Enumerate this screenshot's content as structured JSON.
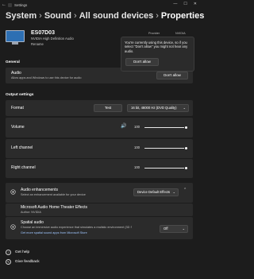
{
  "window": {
    "title": "Settings",
    "back_glyph": "←",
    "min_glyph": "—",
    "max_glyph": "☐",
    "close_glyph": "✕"
  },
  "breadcrumb": {
    "items": [
      "System",
      "Sound",
      "All sound devices",
      "Properties"
    ],
    "separator": "›"
  },
  "device": {
    "name": "ES07D03",
    "subtitle": "NVIDIA High Definition Audio",
    "rename_label": "Rename",
    "provider_label": "Provider",
    "provider_value": "NVIDIA"
  },
  "popup": {
    "message": "You're currently using this device, so if you select \"Don't allow\" you might not hear any audio.",
    "button": "Don't allow"
  },
  "general": {
    "section": "General",
    "audio_title": "Audio",
    "audio_sub": "Allow apps and Windows to use this device for audio",
    "audio_button": "Don't allow"
  },
  "output": {
    "section": "Output settings",
    "format_label": "Format",
    "test_button": "Test",
    "format_value": "16 bit, 48000 Hz (DVD Quality)",
    "volume_label": "Volume",
    "volume_value": "100",
    "left_label": "Left channel",
    "left_value": "100",
    "right_label": "Right channel",
    "right_value": "100",
    "level": 1.0
  },
  "enhancements": {
    "title": "Audio enhancements",
    "sub": "Select an enhancement available for your device",
    "select_value": "Device Default Effects",
    "effect_title": "Microsoft Audio Home Theater Effects",
    "effect_sub": "Author: NVIDIA",
    "spatial_title": "Spatial audio",
    "spatial_sub": "Choose an immersive audio experience that simulates a realistic environment (3D Spatial Sound)",
    "spatial_link": "Get more spatial sound apps from Microsoft Store",
    "spatial_value": "Off"
  },
  "footer": {
    "help": "Get help",
    "feedback": "Give feedback"
  }
}
